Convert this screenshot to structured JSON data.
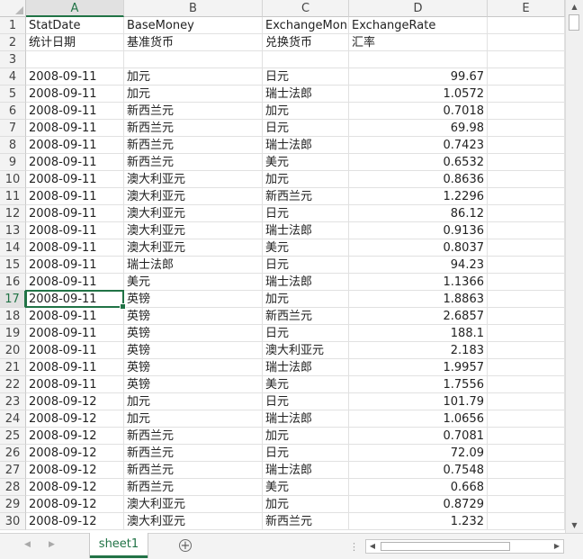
{
  "columns": [
    "A",
    "B",
    "C",
    "D",
    "E"
  ],
  "selected": {
    "column": "A",
    "row": "17"
  },
  "rows": [
    {
      "num": "1",
      "a": "StatDate",
      "b": "BaseMoney",
      "c": "ExchangeMon",
      "d": "ExchangeRate"
    },
    {
      "num": "2",
      "a": "统计日期",
      "b": "基准货币",
      "c": "兑换货币",
      "d": "汇率"
    },
    {
      "num": "3",
      "a": "",
      "b": "",
      "c": "",
      "d": ""
    },
    {
      "num": "4",
      "a": "2008-09-11",
      "b": "加元",
      "c": "日元",
      "d": "99.67"
    },
    {
      "num": "5",
      "a": "2008-09-11",
      "b": "加元",
      "c": "瑞士法郎",
      "d": "1.0572"
    },
    {
      "num": "6",
      "a": "2008-09-11",
      "b": "新西兰元",
      "c": "加元",
      "d": "0.7018"
    },
    {
      "num": "7",
      "a": "2008-09-11",
      "b": "新西兰元",
      "c": "日元",
      "d": "69.98"
    },
    {
      "num": "8",
      "a": "2008-09-11",
      "b": "新西兰元",
      "c": "瑞士法郎",
      "d": "0.7423"
    },
    {
      "num": "9",
      "a": "2008-09-11",
      "b": "新西兰元",
      "c": "美元",
      "d": "0.6532"
    },
    {
      "num": "10",
      "a": "2008-09-11",
      "b": "澳大利亚元",
      "c": "加元",
      "d": "0.8636"
    },
    {
      "num": "11",
      "a": "2008-09-11",
      "b": "澳大利亚元",
      "c": "新西兰元",
      "d": "1.2296"
    },
    {
      "num": "12",
      "a": "2008-09-11",
      "b": "澳大利亚元",
      "c": "日元",
      "d": "86.12"
    },
    {
      "num": "13",
      "a": "2008-09-11",
      "b": "澳大利亚元",
      "c": "瑞士法郎",
      "d": "0.9136"
    },
    {
      "num": "14",
      "a": "2008-09-11",
      "b": "澳大利亚元",
      "c": "美元",
      "d": "0.8037"
    },
    {
      "num": "15",
      "a": "2008-09-11",
      "b": "瑞士法郎",
      "c": "日元",
      "d": "94.23"
    },
    {
      "num": "16",
      "a": "2008-09-11",
      "b": "美元",
      "c": "瑞士法郎",
      "d": "1.1366"
    },
    {
      "num": "17",
      "a": "2008-09-11",
      "b": "英镑",
      "c": "加元",
      "d": "1.8863"
    },
    {
      "num": "18",
      "a": "2008-09-11",
      "b": "英镑",
      "c": "新西兰元",
      "d": "2.6857"
    },
    {
      "num": "19",
      "a": "2008-09-11",
      "b": "英镑",
      "c": "日元",
      "d": "188.1"
    },
    {
      "num": "20",
      "a": "2008-09-11",
      "b": "英镑",
      "c": "澳大利亚元",
      "d": "2.183"
    },
    {
      "num": "21",
      "a": "2008-09-11",
      "b": "英镑",
      "c": "瑞士法郎",
      "d": "1.9957"
    },
    {
      "num": "22",
      "a": "2008-09-11",
      "b": "英镑",
      "c": "美元",
      "d": "1.7556"
    },
    {
      "num": "23",
      "a": "2008-09-12",
      "b": "加元",
      "c": "日元",
      "d": "101.79"
    },
    {
      "num": "24",
      "a": "2008-09-12",
      "b": "加元",
      "c": "瑞士法郎",
      "d": "1.0656"
    },
    {
      "num": "25",
      "a": "2008-09-12",
      "b": "新西兰元",
      "c": "加元",
      "d": "0.7081"
    },
    {
      "num": "26",
      "a": "2008-09-12",
      "b": "新西兰元",
      "c": "日元",
      "d": "72.09"
    },
    {
      "num": "27",
      "a": "2008-09-12",
      "b": "新西兰元",
      "c": "瑞士法郎",
      "d": "0.7548"
    },
    {
      "num": "28",
      "a": "2008-09-12",
      "b": "新西兰元",
      "c": "美元",
      "d": "0.668"
    },
    {
      "num": "29",
      "a": "2008-09-12",
      "b": "澳大利亚元",
      "c": "加元",
      "d": "0.8729"
    },
    {
      "num": "30",
      "a": "2008-09-12",
      "b": "澳大利亚元",
      "c": "新西兰元",
      "d": "1.232"
    }
  ],
  "sheet_tabs": [
    "sheet1"
  ],
  "icons": {
    "add_sheet": "plus-circle-icon",
    "scroll_up": "triangle-up-icon",
    "scroll_down": "triangle-down-icon",
    "scroll_left": "triangle-left-icon",
    "scroll_right": "triangle-right-icon"
  },
  "colors": {
    "accent": "#217346"
  }
}
